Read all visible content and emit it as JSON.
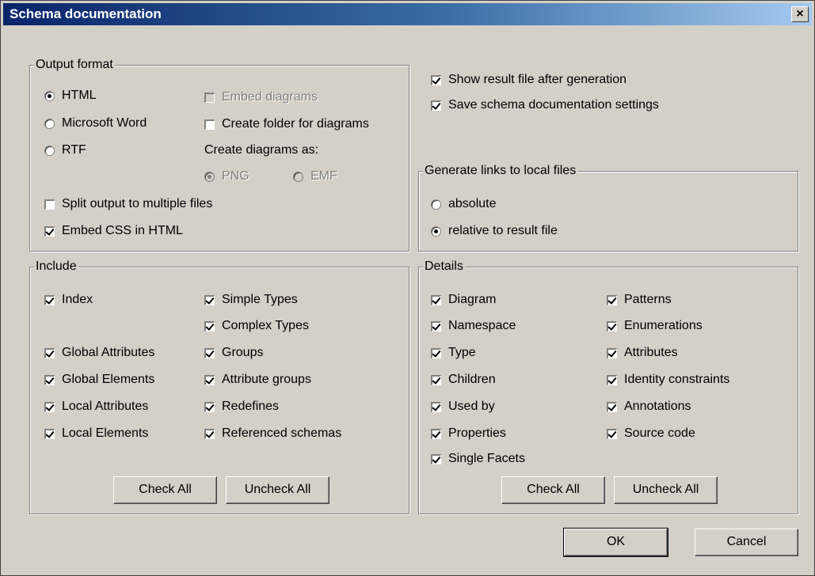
{
  "window": {
    "title": "Schema documentation",
    "close": "×"
  },
  "output_format": {
    "legend": "Output format",
    "html": "HTML",
    "word": "Microsoft Word",
    "rtf": "RTF",
    "embed_diagrams": "Embed diagrams",
    "create_folder": "Create folder for diagrams",
    "create_diagrams_as": "Create diagrams as:",
    "png": "PNG",
    "emf": "EMF",
    "split_output": "Split output to multiple files",
    "embed_css": "Embed CSS in HTML"
  },
  "options": {
    "show_result": "Show result file after generation",
    "save_settings": "Save schema documentation settings"
  },
  "links": {
    "legend": "Generate links to local files",
    "absolute": "absolute",
    "relative": "relative to result file"
  },
  "include": {
    "legend": "Include",
    "index": "Index",
    "simple_types": "Simple Types",
    "complex_types": "Complex Types",
    "global_attributes": "Global Attributes",
    "groups": "Groups",
    "global_elements": "Global Elements",
    "attribute_groups": "Attribute groups",
    "local_attributes": "Local Attributes",
    "redefines": "Redefines",
    "local_elements": "Local Elements",
    "referenced_schemas": "Referenced schemas",
    "check_all": "Check All",
    "uncheck_all": "Uncheck All"
  },
  "details": {
    "legend": "Details",
    "diagram": "Diagram",
    "patterns": "Patterns",
    "namespace": "Namespace",
    "enumerations": "Enumerations",
    "type": "Type",
    "attributes": "Attributes",
    "children": "Children",
    "identity_constraints": "Identity constraints",
    "used_by": "Used by",
    "annotations": "Annotations",
    "properties": "Properties",
    "source_code": "Source code",
    "single_facets": "Single Facets",
    "check_all": "Check All",
    "uncheck_all": "Uncheck All"
  },
  "buttons": {
    "ok": "OK",
    "cancel": "Cancel"
  }
}
